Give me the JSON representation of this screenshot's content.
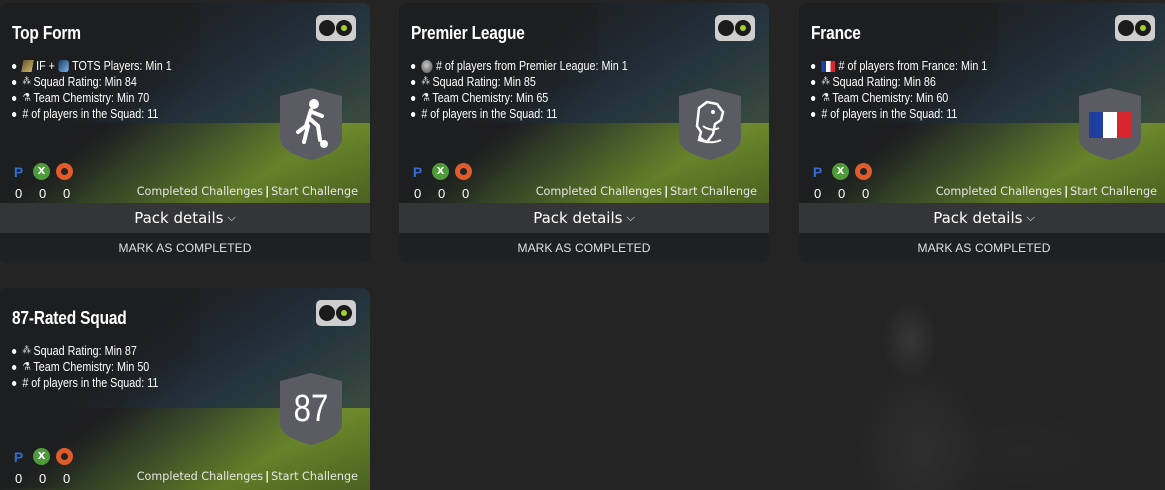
{
  "cards": [
    {
      "title": "Top Form",
      "requirements": [
        {
          "icon": "if-tots-icons",
          "text": "TOTS Players: Min 1",
          "prefix": "IF +"
        },
        {
          "icon": "stars-icon",
          "text": "Squad Rating: Min 84"
        },
        {
          "icon": "flask-icon",
          "text": "Team Chemistry: Min 70"
        },
        {
          "icon": "",
          "text": "# of players in the Squad: 11"
        }
      ],
      "badge": {
        "type": "player-icon",
        "text": ""
      },
      "counts": [
        "0",
        "0",
        "0"
      ],
      "completed_label": "Completed Challenges",
      "start_label": "Start Challenge",
      "pack_details_label": "Pack details",
      "mark_label": "MARK AS COMPLETED"
    },
    {
      "title": "Premier League",
      "requirements": [
        {
          "icon": "league-icon",
          "text": "# of players from Premier League: Min 1"
        },
        {
          "icon": "stars-icon",
          "text": "Squad Rating: Min 85"
        },
        {
          "icon": "flask-icon",
          "text": "Team Chemistry: Min 65"
        },
        {
          "icon": "",
          "text": "# of players in the Squad: 11"
        }
      ],
      "badge": {
        "type": "premier-league-icon",
        "text": ""
      },
      "counts": [
        "0",
        "0",
        "0"
      ],
      "completed_label": "Completed Challenges",
      "start_label": "Start Challenge",
      "pack_details_label": "Pack details",
      "mark_label": "MARK AS COMPLETED"
    },
    {
      "title": "France",
      "requirements": [
        {
          "icon": "france-flag-icon",
          "text": "# of players from France: Min 1"
        },
        {
          "icon": "stars-icon",
          "text": "Squad Rating: Min 86"
        },
        {
          "icon": "flask-icon",
          "text": "Team Chemistry: Min 60"
        },
        {
          "icon": "",
          "text": "# of players in the Squad: 11"
        }
      ],
      "badge": {
        "type": "france-flag-badge",
        "text": ""
      },
      "counts": [
        "0",
        "0",
        "0"
      ],
      "completed_label": "Completed Challenges",
      "start_label": "Start Challenge",
      "pack_details_label": "Pack details",
      "mark_label": "MARK AS COMPLETED"
    },
    {
      "title": "87-Rated Squad",
      "requirements": [
        {
          "icon": "stars-icon",
          "text": "Squad Rating: Min 87"
        },
        {
          "icon": "flask-icon",
          "text": "Team Chemistry: Min 50"
        },
        {
          "icon": "",
          "text": "# of players in the Squad: 11"
        }
      ],
      "badge": {
        "type": "rating-badge",
        "text": "87"
      },
      "counts": [
        "0",
        "0",
        "0"
      ],
      "completed_label": "Completed Challenges",
      "start_label": "Start Challenge"
    }
  ],
  "colors": {
    "background": "#242424",
    "card": "#1e1f21",
    "pack_details_bar": "#343537",
    "toggle_on": "#a3d12a",
    "playstation": "#2f6fcf",
    "xbox": "#4f9a3a",
    "pc": "#e05a2a"
  }
}
